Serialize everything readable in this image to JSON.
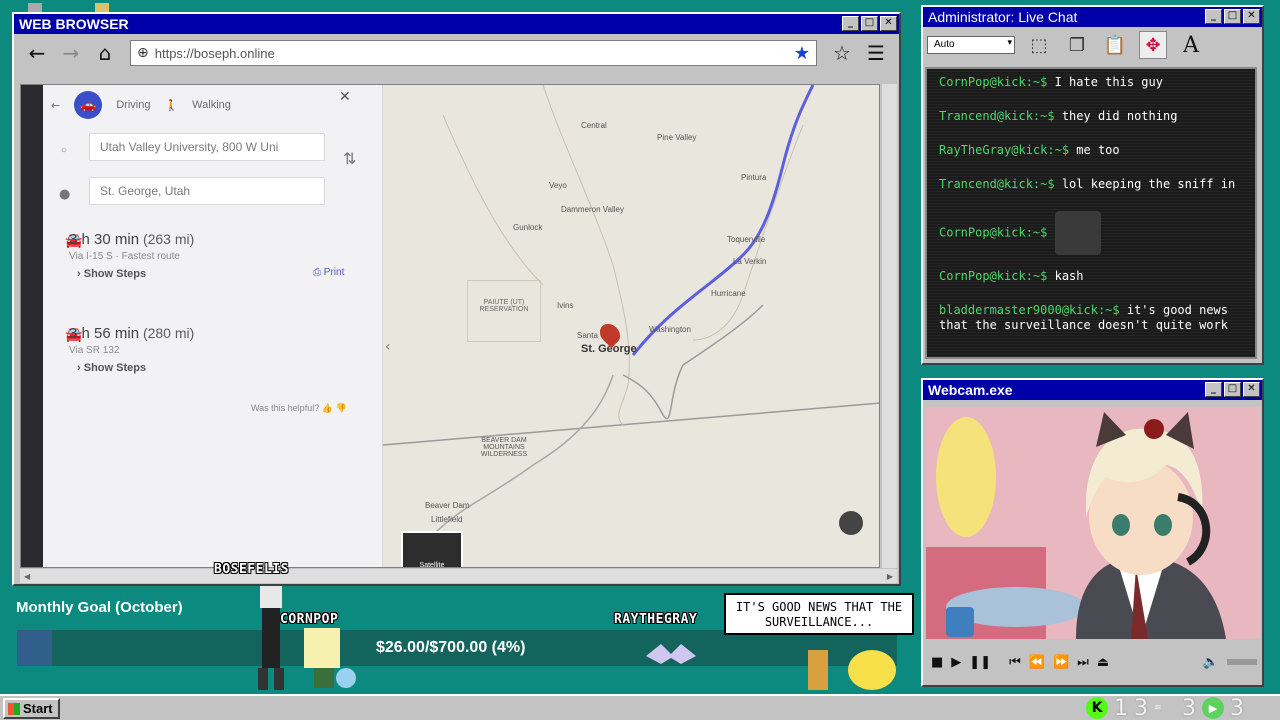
{
  "browser": {
    "title": "WEB BROWSER",
    "url": "https://boseph.online",
    "map": {
      "mode_driving": "Driving",
      "mode_walking": "Walking",
      "from": "Utah Valley University, 800 W Uni",
      "to": "St. George, Utah",
      "routes": [
        {
          "duration": "3 h 30 min",
          "distance": "(263 mi)",
          "via": "Via I-15 S · Fastest route",
          "steps": "Show Steps"
        },
        {
          "duration": "3 h 56 min",
          "distance": "(280 mi)",
          "via": "Via SR 132",
          "steps": "Show Steps"
        }
      ],
      "print": "Print",
      "helpful": "Was this helpful?",
      "places": [
        "Central",
        "Pine Valley",
        "Veyo",
        "Dammeron Valley",
        "Gunlock",
        "Ivins",
        "Santa Clara",
        "Washington",
        "Hurricane",
        "La Verkin",
        "Toquerville",
        "Pintura"
      ],
      "city": "St. George",
      "reservation": "PAIUTE (UT) RESERVATION",
      "wilderness": "BEAVER DAM MOUNTAINS WILDERNESS",
      "littlefield": "Littlefield",
      "beaver_dam": "Beaver Dam",
      "satellite": "Satellite"
    }
  },
  "chat": {
    "title": "Administrator: Live Chat",
    "font_size": "Auto",
    "messages": [
      {
        "user": "CornPop@kick:~$",
        "text": "I hate this guy"
      },
      {
        "user": "Trancend@kick:~$",
        "text": "they did nothing"
      },
      {
        "user": "RayTheGray@kick:~$",
        "text": "me too"
      },
      {
        "user": "Trancend@kick:~$",
        "text": "lol keeping the sniff in"
      },
      {
        "user": "CornPop@kick:~$",
        "text": ""
      },
      {
        "user": "CornPop@kick:~$",
        "text": "kash"
      },
      {
        "user": "bladdermaster9000@kick:~$",
        "text": "it's good news that the surveillance doesn't quite work"
      }
    ]
  },
  "webcam": {
    "title": "Webcam.exe"
  },
  "goal": {
    "title": "Monthly Goal (October)",
    "text": "$26.00/$700.00 (4%)",
    "fraction": 0.04
  },
  "overlay": {
    "label_bosefelis": "BOSEFELIS",
    "label_cornpop": "CORNPOP",
    "label_raythegray": "RAYTHEGRAY",
    "speech": "IT'S GOOD NEWS THAT THE SURVEILLANCE..."
  },
  "taskbar": {
    "start": "Start",
    "tray1": "1",
    "tray2": "3",
    "tray3": "3",
    "tray4": "3"
  },
  "colors": {
    "desktop": "#0c8a7f",
    "titlebar": "#0000a8",
    "chat_user": "#4dd66a",
    "route_line": "#5b5fe0"
  }
}
